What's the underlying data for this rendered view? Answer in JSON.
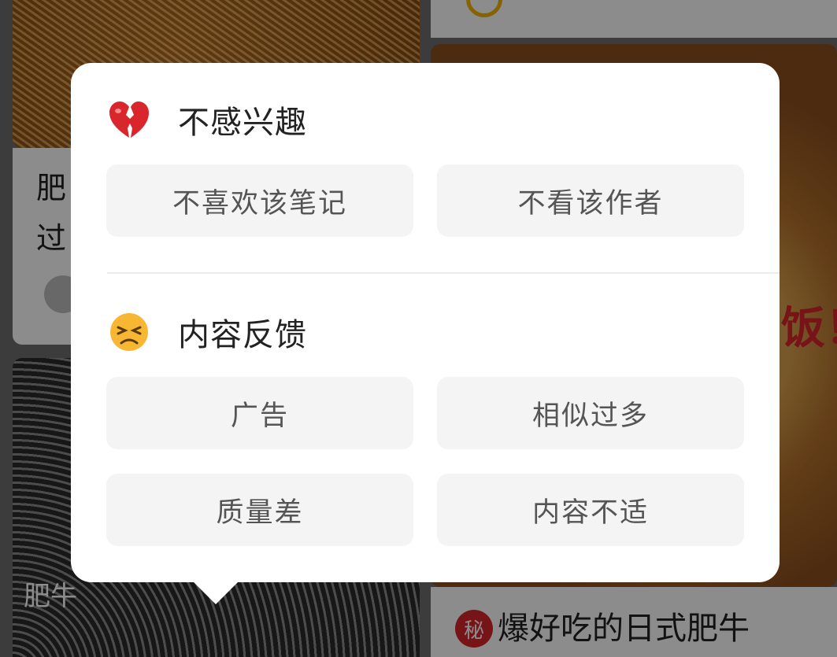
{
  "background": {
    "left_card_title_line1": "肥",
    "left_card_title_line2": "过",
    "right_card_title": "爆好吃的日式肥牛",
    "right_card_badge": "秘",
    "right_overlay_text": "饭！",
    "left_image_text": "肥牛"
  },
  "popup": {
    "section_not_interested": {
      "title": "不感兴趣",
      "icon": "broken-heart-icon",
      "options": [
        "不喜欢该笔记",
        "不看该作者"
      ]
    },
    "section_feedback": {
      "title": "内容反馈",
      "icon": "persevering-face-icon",
      "options": [
        "广告",
        "相似过多",
        "质量差",
        "内容不适"
      ]
    }
  },
  "colors": {
    "popup_bg": "#ffffff",
    "option_bg": "#f4f4f4",
    "option_text": "#555555",
    "title_text": "#222222",
    "heart_red": "#d9252c",
    "face_yellow": "#f7b733"
  }
}
